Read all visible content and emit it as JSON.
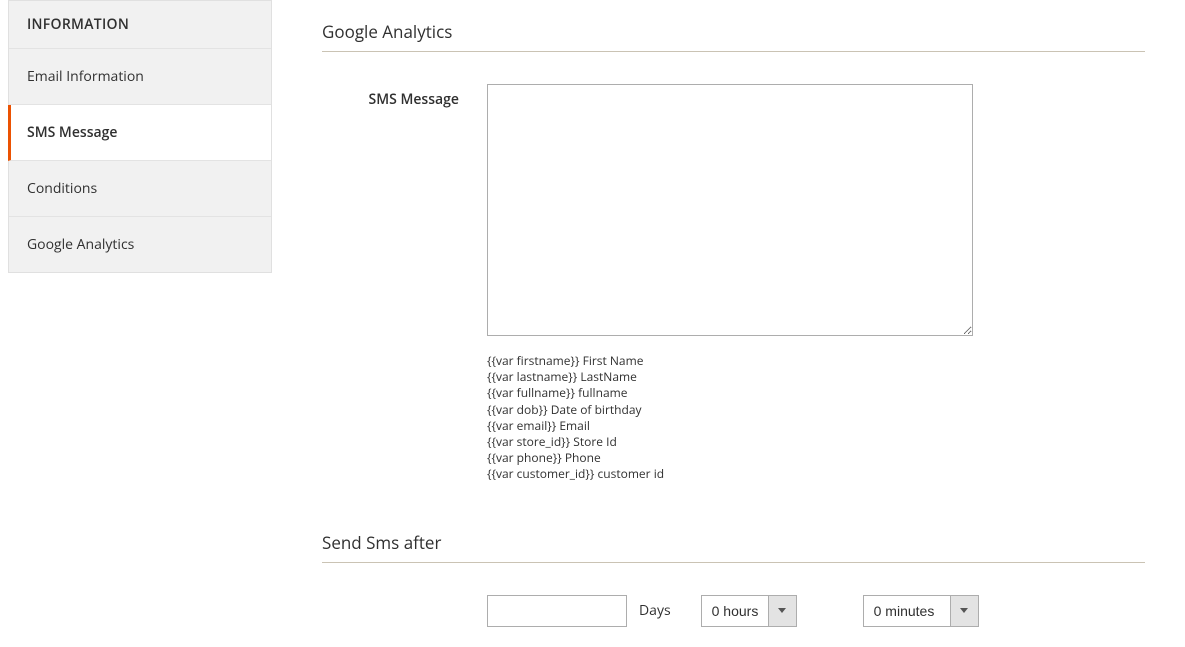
{
  "sidebar": {
    "header": "INFORMATION",
    "items": [
      {
        "label": "Email Information",
        "active": false
      },
      {
        "label": "SMS Message",
        "active": true
      },
      {
        "label": "Conditions",
        "active": false
      },
      {
        "label": "Google Analytics",
        "active": false
      }
    ]
  },
  "section_title": "Google Analytics",
  "sms_field": {
    "label": "SMS Message",
    "value": ""
  },
  "hints": [
    "{{var firstname}} First Name",
    "{{var lastname}} LastName",
    "{{var fullname}} fullname",
    "{{var dob}} Date of birthday",
    "{{var email}} Email",
    "{{var store_id}} Store Id",
    "{{var phone}} Phone",
    "{{var customer_id}} customer id"
  ],
  "section2_title": "Send Sms after",
  "schedule": {
    "days_value": "",
    "days_label": "Days",
    "hours_options": [
      "0 hours"
    ],
    "hours_selected": "0 hours",
    "minutes_options": [
      "0 minutes"
    ],
    "minutes_selected": "0 minutes"
  }
}
